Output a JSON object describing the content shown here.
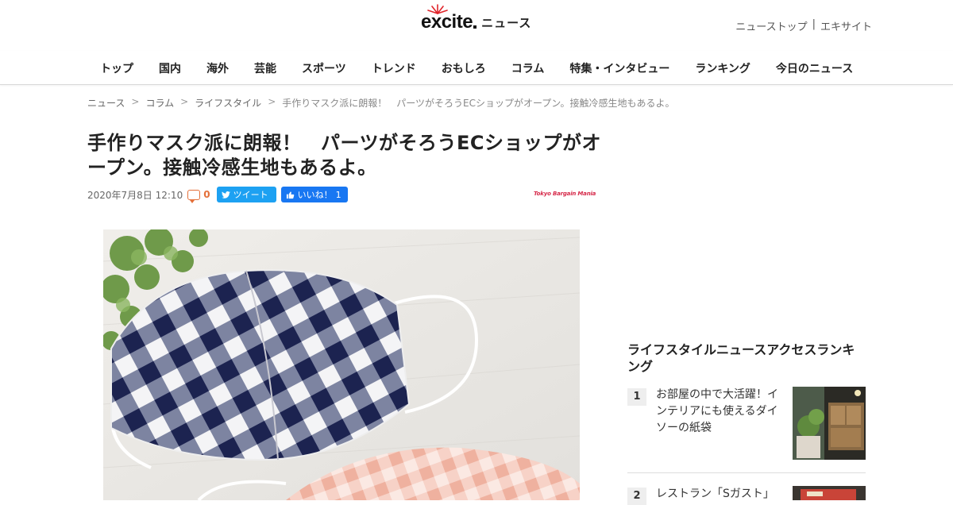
{
  "header": {
    "logo_text": "ニュース",
    "logo_mark": "excite",
    "links": [
      "ニューストップ",
      "|",
      "エキサイト"
    ]
  },
  "nav": {
    "items": [
      "トップ",
      "国内",
      "海外",
      "芸能",
      "スポーツ",
      "トレンド",
      "おもしろ",
      "コラム",
      "特集・インタビュー",
      "ランキング",
      "今日のニュース"
    ]
  },
  "breadcrumb": {
    "items": [
      "ニュース",
      "コラム",
      "ライフスタイル"
    ],
    "separator": ">",
    "current": "手作りマスク派に朗報！　パーツがそろうECショップがオープン。接触冷感生地もあるよ。"
  },
  "article": {
    "title": "手作りマスク派に朗報！　パーツがそろうECショップがオープン。接触冷感生地もあるよ。",
    "date": "2020年7月8日 12:10",
    "comment_count": "0",
    "tweet_label": "ツイート",
    "like_label": "いいね！",
    "like_count": "1",
    "source": "Tokyo Bargain Mania"
  },
  "sidebar": {
    "ranking_title": "ライフスタイルニュースアクセスランキング",
    "items": [
      {
        "rank": "1",
        "title": "お部屋の中で大活躍！インテリアにも使えるダイソーの紙袋"
      },
      {
        "rank": "2",
        "title": "レストラン「Sガスト」"
      }
    ]
  },
  "colors": {
    "twitter": "#1da1f2",
    "facebook": "#1877f2",
    "comment": "#e4703a",
    "source_logo": "#d62a4a"
  }
}
